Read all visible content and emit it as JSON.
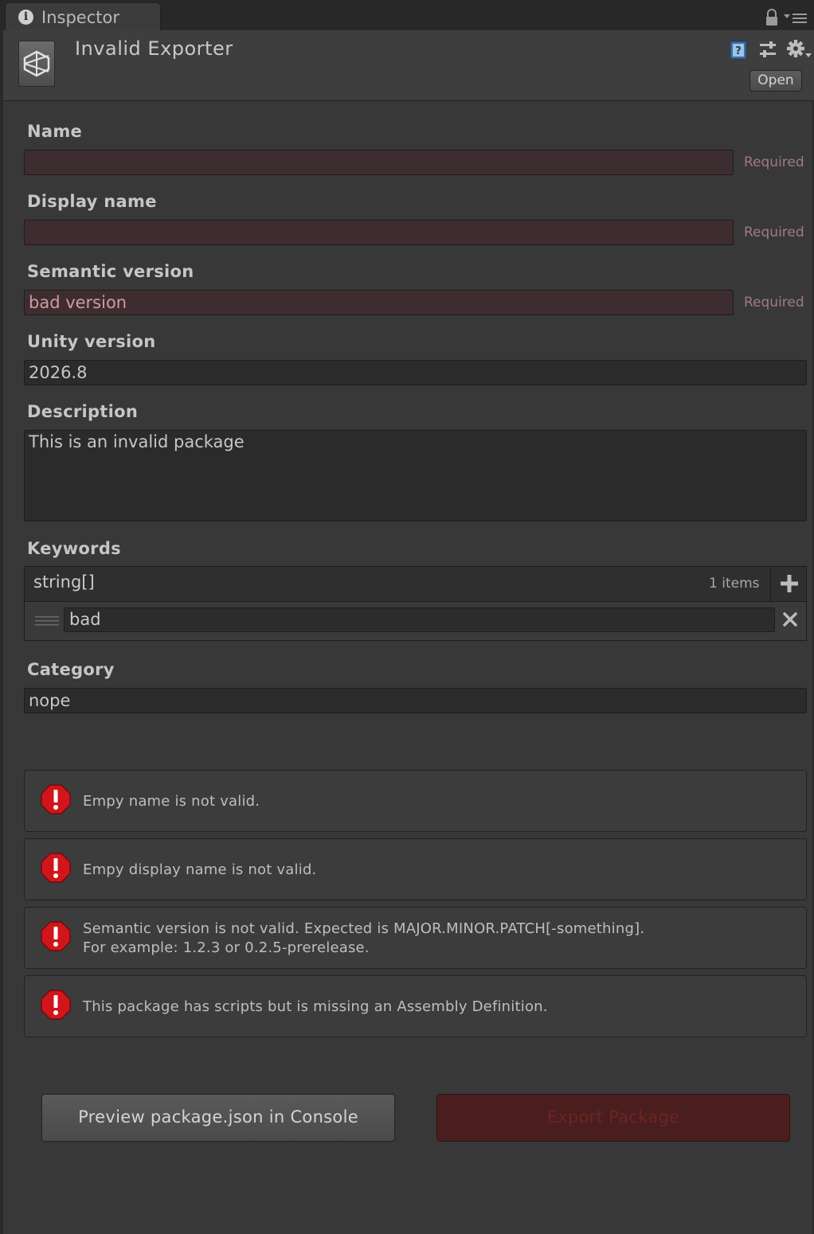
{
  "tab": {
    "title": "Inspector"
  },
  "header": {
    "title": "Invalid Exporter",
    "open_label": "Open"
  },
  "fields": {
    "name": {
      "label": "Name",
      "value": "",
      "required_label": "Required"
    },
    "display_name": {
      "label": "Display name",
      "value": "",
      "required_label": "Required"
    },
    "semantic_version": {
      "label": "Semantic version",
      "value": "bad version",
      "required_label": "Required"
    },
    "unity_version": {
      "label": "Unity version",
      "value": "2026.8"
    },
    "description": {
      "label": "Description",
      "value": "This is an invalid package"
    },
    "keywords": {
      "label": "Keywords",
      "type": "string[]",
      "count_label": "1 items",
      "items": [
        "bad"
      ]
    },
    "category": {
      "label": "Category",
      "value": "nope"
    }
  },
  "errors": [
    {
      "line1": "Empy name is not valid.",
      "line2": ""
    },
    {
      "line1": "Empy display name is not valid.",
      "line2": ""
    },
    {
      "line1": "Semantic version is not valid. Expected is MAJOR.MINOR.PATCH[-something].",
      "line2": "For example: 1.2.3 or 0.2.5-prerelease."
    },
    {
      "line1": "This package has scripts but is missing an Assembly Definition.",
      "line2": ""
    }
  ],
  "buttons": {
    "preview": "Preview package.json in Console",
    "export": "Export Package"
  },
  "colors": {
    "invalid_field_bg": "#3e2d30",
    "required_text": "#a27a81",
    "error_icon": "#d0161b",
    "export_disabled_bg": "#4a1e1e"
  },
  "icons": [
    "info-icon",
    "lock-icon",
    "menu-icon",
    "unity-logo-icon",
    "help-icon",
    "presets-icon",
    "gear-icon",
    "plus-icon",
    "drag-handle-icon",
    "close-icon",
    "error-icon"
  ]
}
